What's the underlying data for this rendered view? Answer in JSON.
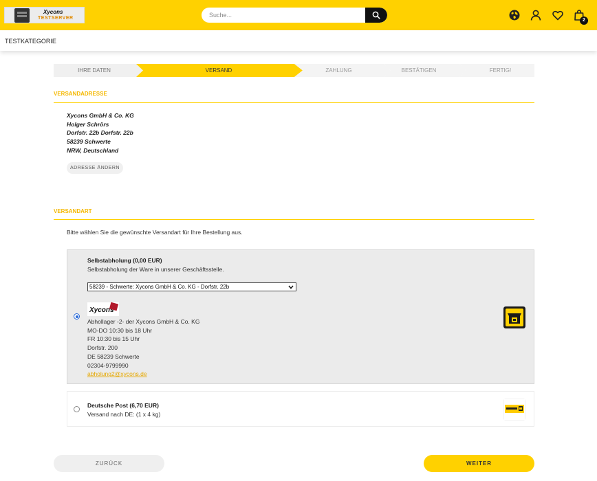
{
  "header": {
    "logo_name": "Xycons",
    "logo_sub": "TESTSERVER",
    "search_placeholder": "Suche...",
    "cart_count": "2",
    "icons": [
      "globe-icon",
      "user-icon",
      "heart-icon",
      "shopping-bag-icon",
      "search-icon"
    ],
    "accent_color": "#ffd100"
  },
  "category_bar": {
    "label": "TESTKATEGORIE"
  },
  "checkout_steps": [
    {
      "label": "IHRE DATEN",
      "state": "done"
    },
    {
      "label": "VERSAND",
      "state": "active"
    },
    {
      "label": "ZAHLUNG",
      "state": "pending"
    },
    {
      "label": "BESTÄTIGEN",
      "state": "pending"
    },
    {
      "label": "FERTIG!",
      "state": "pending"
    }
  ],
  "shipping_address": {
    "title": "VERSANDADRESSE",
    "lines": [
      "Xycons GmbH & Co. KG",
      "Holger Schrörs",
      "Dorfstr. 22b Dorfstr. 22b",
      "58239 Schwerte",
      "NRW, Deutschland"
    ],
    "change_button": "ADRESSE ÄNDERN"
  },
  "shipping_method": {
    "title": "VERSANDART",
    "intro": "Bitte wählen Sie die gewünschte Versandart für Ihre Bestellung aus.",
    "options": [
      {
        "title": "Selbstabholung (0,00 EUR)",
        "description": "Selbstabholung der Ware in unserer Geschäftsstelle.",
        "selected": true,
        "store_select_value": "58239 - Schwerte: Xycons GmbH & Co. KG - Dorfstr. 22b",
        "store_logo": "Xycons",
        "store_lines": [
          "Abhollager -2- der Xycons GmbH & Co. KG",
          "MO-DO 10:30 bis 18 Uhr",
          "FR 10:30 bis 15 Uhr",
          "Dorfstr. 200",
          "DE 58239 Schwerte",
          "02304-9799990"
        ],
        "store_email": "abholung2@xycons.de",
        "icon": "store-pickup-icon"
      },
      {
        "title": "Deutsche Post (6,70 EUR)",
        "description": "Versand nach DE: (1 x 4 kg)",
        "selected": false,
        "icon": "deutsche-post-icon"
      }
    ]
  },
  "buttons": {
    "back": "ZURÜCK",
    "next": "WEITER"
  }
}
